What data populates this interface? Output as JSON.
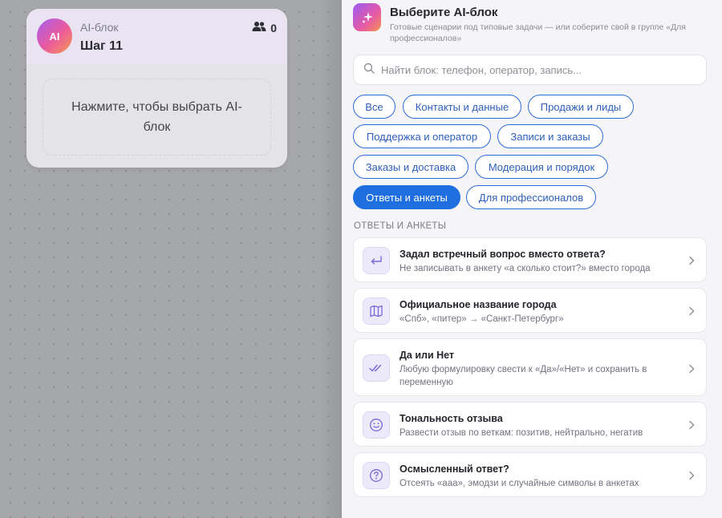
{
  "node": {
    "kind": "AI-блок",
    "title": "Шаг 11",
    "avatar": "AI",
    "members": "0",
    "placeholder": "Нажмите, чтобы выбрать AI-блок"
  },
  "panel": {
    "title": "Выберите AI-блок",
    "subtitle": "Готовые сценарии под типовые задачи — или соберите свой в группе «Для профессионалов»",
    "search_placeholder": "Найти блок: телефон, оператор, запись...",
    "chips": [
      "Все",
      "Контакты и данные",
      "Продажи и лиды",
      "Поддержка и оператор",
      "Записи и заказы",
      "Заказы и доставка",
      "Модерация и порядок",
      "Ответы и анкеты",
      "Для профессионалов"
    ],
    "active_chip": "Ответы и анкеты",
    "section_label": "ОТВЕТЫ И АНКЕТЫ",
    "cards": [
      {
        "title": "Задал встречный вопрос вместо ответа?",
        "desc": "Не записывать в анкету «а сколько стоит?» вместо города",
        "icon": "return-arrow-icon"
      },
      {
        "title": "Официальное название города",
        "desc": "«Спб», «питер» → «Санкт-Петербург»",
        "icon": "map-icon"
      },
      {
        "title": "Да или Нет",
        "desc": "Любую формулировку свести к «Да»/«Нет» и сохранить в переменную",
        "icon": "double-check-icon"
      },
      {
        "title": "Тональность отзыва",
        "desc": "Развести отзыв по веткам: позитив, нейтрально, негатив",
        "icon": "smile-icon"
      },
      {
        "title": "Осмысленный ответ?",
        "desc": "Отсеять «ааа», эмодзи и случайные символы в анкетах",
        "icon": "question-circle-icon"
      }
    ]
  },
  "colors": {
    "accent": "#1f6fe0",
    "chip_border": "#2d6ad6",
    "icon_bg": "#ece9fb",
    "icon_stroke": "#7c67d9"
  }
}
